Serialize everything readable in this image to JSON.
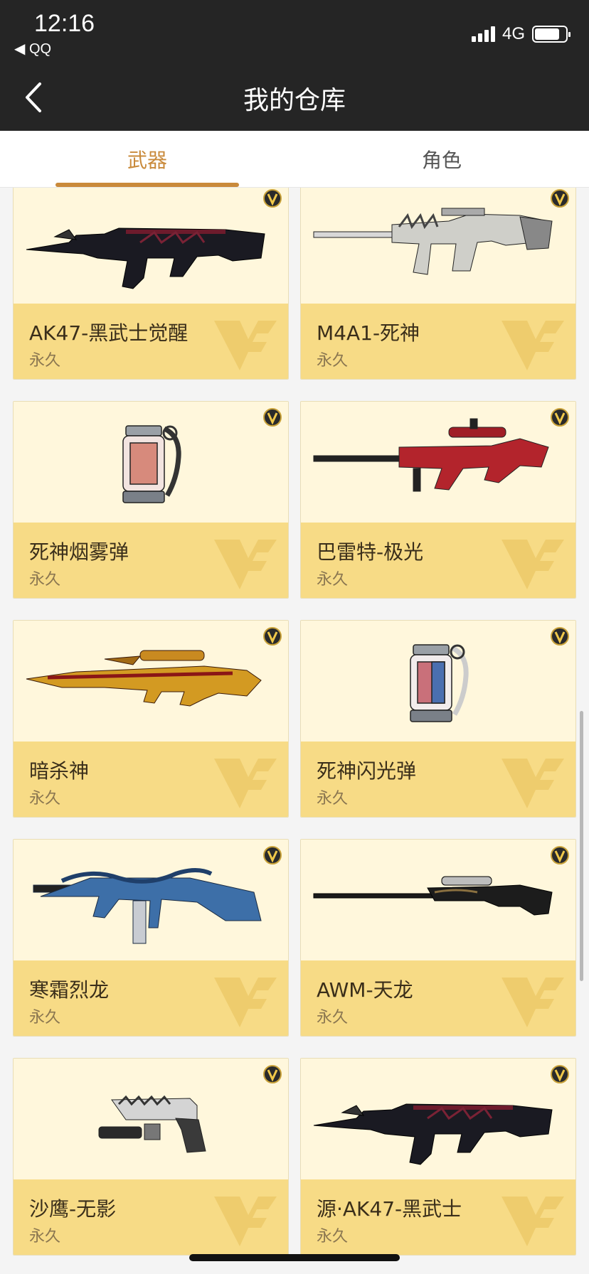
{
  "status_bar": {
    "time": "12:16",
    "back_app": "◀ QQ",
    "network": "4G"
  },
  "nav": {
    "title": "我的仓库"
  },
  "tabs": [
    {
      "label": "武器",
      "active": true
    },
    {
      "label": "角色",
      "active": false
    }
  ],
  "items": [
    {
      "name": "AK47-黑武士觉醒",
      "duration": "永久",
      "image": "rifle-black"
    },
    {
      "name": "M4A1-死神",
      "duration": "永久",
      "image": "rifle-silver"
    },
    {
      "name": "死神烟雾弹",
      "duration": "永久",
      "image": "grenade-red"
    },
    {
      "name": "巴雷特-极光",
      "duration": "永久",
      "image": "sniper-red"
    },
    {
      "name": "暗杀神",
      "duration": "永久",
      "image": "rifle-gold"
    },
    {
      "name": "死神闪光弹",
      "duration": "永久",
      "image": "grenade-blue"
    },
    {
      "name": "寒霜烈龙",
      "duration": "永久",
      "image": "smg-blue"
    },
    {
      "name": "AWM-天龙",
      "duration": "永久",
      "image": "sniper-black"
    },
    {
      "name": "沙鹰-无影",
      "duration": "永久",
      "image": "pistol-silver"
    },
    {
      "name": "源·AK47-黑武士",
      "duration": "永久",
      "image": "rifle-black"
    }
  ],
  "colors": {
    "accent": "#c98a3b",
    "header_bg": "#252525",
    "card_image_bg": "#fff7dc",
    "card_info_bg": "#f7db86"
  }
}
